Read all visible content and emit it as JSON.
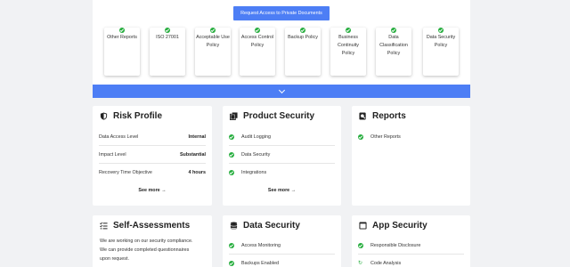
{
  "request_button": "Request Access to Private Documents",
  "documents": [
    "Other Reports",
    "ISO 27001",
    "Acceptable Use Policy",
    "Access Control Policy",
    "Backup Policy",
    "Business Continuity Policy",
    "Data Classification Policy",
    "Data Security Policy"
  ],
  "risk_profile": {
    "title": "Risk Profile",
    "rows": [
      {
        "label": "Data Access Level",
        "value": "Internal"
      },
      {
        "label": "Impact Level",
        "value": "Substantial"
      },
      {
        "label": "Recovery Time Objective",
        "value": "4 hours"
      }
    ],
    "see_more": "See more"
  },
  "product_security": {
    "title": "Product Security",
    "items": [
      "Audit Logging",
      "Data Security",
      "Integrations"
    ],
    "see_more": "See more"
  },
  "reports": {
    "title": "Reports",
    "items": [
      "Other Reports"
    ]
  },
  "self_assessments": {
    "title": "Self-Assessments",
    "text_lines": [
      "We are working on our security compliance.",
      "We can provide completed questionnaires",
      "upon request."
    ]
  },
  "data_security": {
    "title": "Data Security",
    "items": [
      "Access Monitoring",
      "Backups Enabled"
    ]
  },
  "app_security": {
    "title": "App Security",
    "items": [
      "Responsible Disclosure",
      "Code Analysis"
    ]
  },
  "colors": {
    "accent": "#4d7ef5",
    "check": "#27ae3f",
    "background": "#f1f2f4"
  }
}
